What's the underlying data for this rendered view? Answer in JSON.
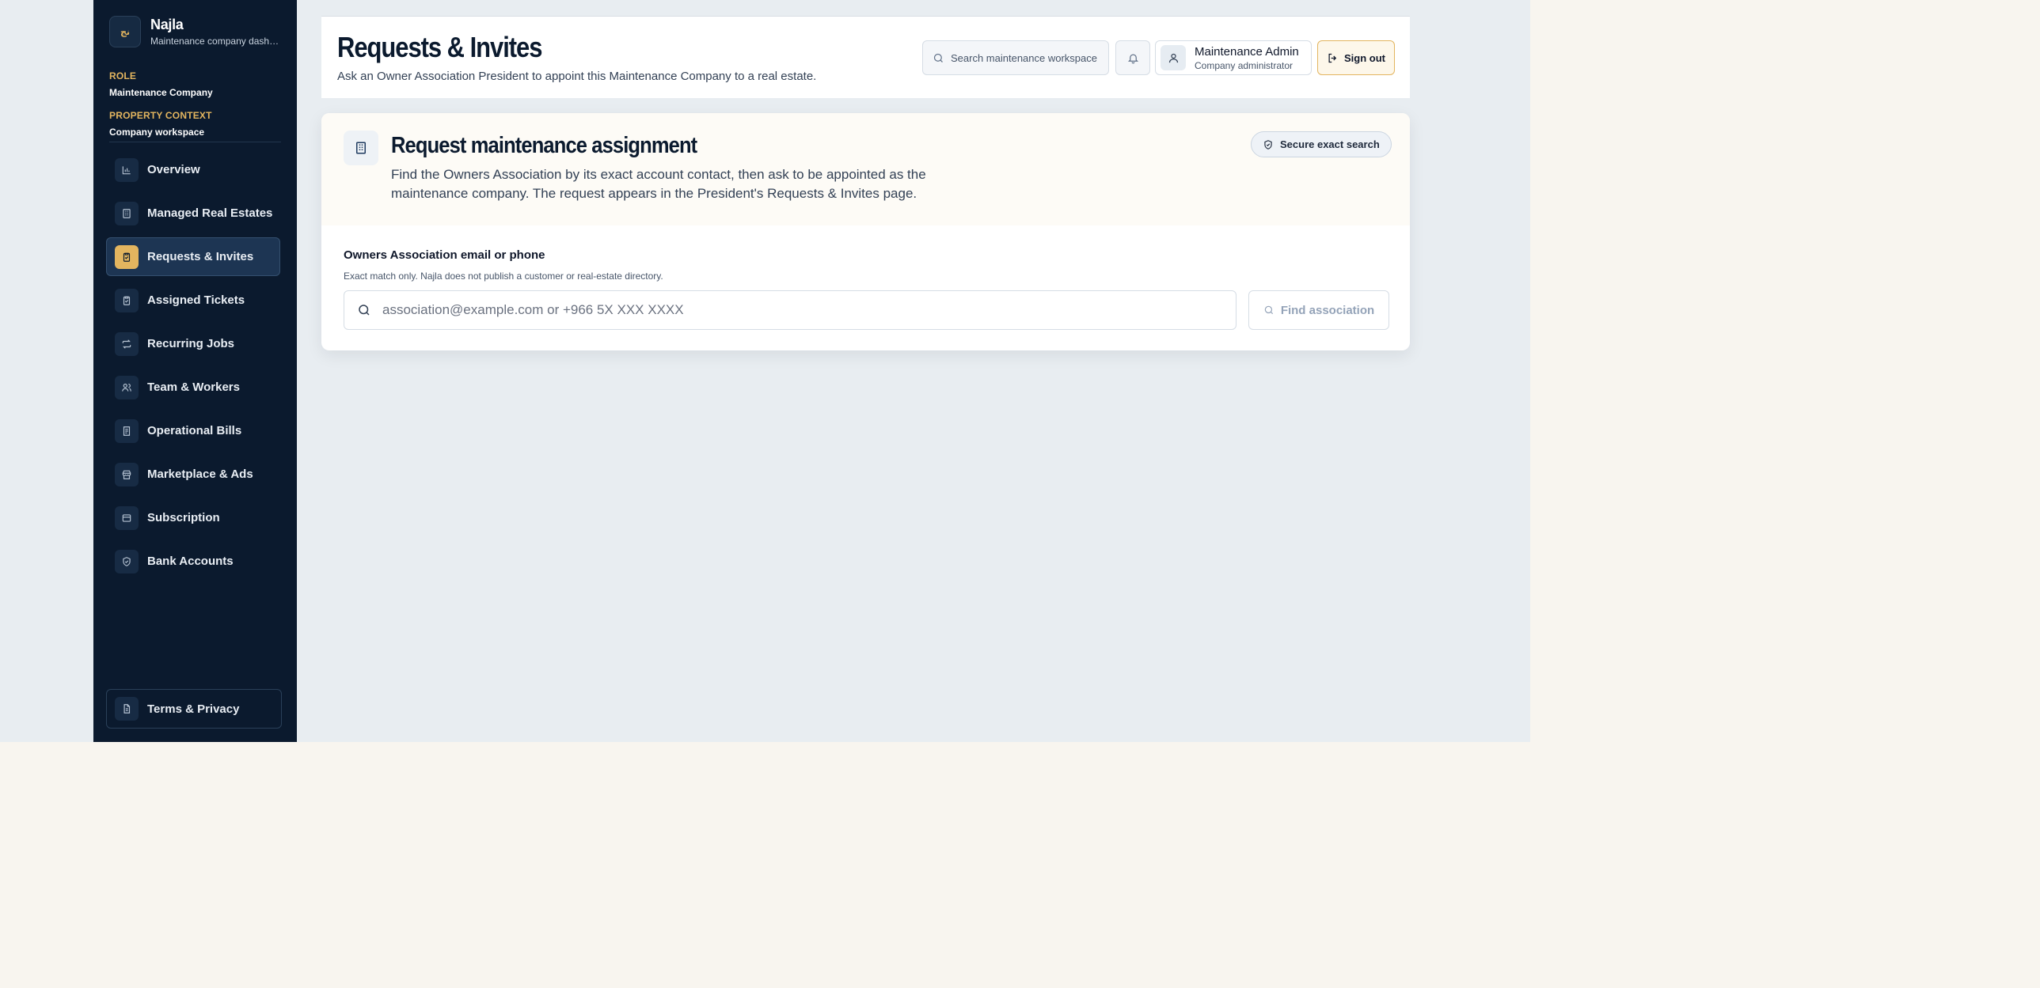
{
  "brand": {
    "name": "Najla",
    "subtitle": "Maintenance company dashboard",
    "logo_text": "نج"
  },
  "role": {
    "key": "ROLE",
    "value": "Maintenance Company"
  },
  "property_context": {
    "key": "PROPERTY CONTEXT",
    "value": "Company workspace"
  },
  "nav": {
    "items": [
      {
        "label": "Overview",
        "icon": "bar-chart-icon"
      },
      {
        "label": "Managed Real Estates",
        "icon": "building-icon"
      },
      {
        "label": "Requests & Invites",
        "icon": "clipboard-icon",
        "active": true
      },
      {
        "label": "Assigned Tickets",
        "icon": "clipboard-check-icon"
      },
      {
        "label": "Recurring Jobs",
        "icon": "repeat-icon"
      },
      {
        "label": "Team & Workers",
        "icon": "users-icon"
      },
      {
        "label": "Operational Bills",
        "icon": "receipt-icon"
      },
      {
        "label": "Marketplace & Ads",
        "icon": "store-icon"
      },
      {
        "label": "Subscription",
        "icon": "wallet-icon"
      },
      {
        "label": "Bank Accounts",
        "icon": "shield-icon"
      }
    ],
    "terms_label": "Terms & Privacy"
  },
  "header": {
    "title": "Requests & Invites",
    "subtitle": "Ask an Owner Association President to appoint this Maintenance Company to a real estate.",
    "search_placeholder": "Search maintenance workspace",
    "user_name": "Maintenance Admin",
    "user_role": "Company administrator",
    "signout_label": "Sign out"
  },
  "card": {
    "title": "Request maintenance assignment",
    "description": "Find the Owners Association by its exact account contact, then ask to be appointed as the maintenance company. The request appears in the President's Requests & Invites page.",
    "badge": "Secure exact search",
    "field_label": "Owners Association email or phone",
    "field_help": "Exact match only. Najla does not publish a customer or real-estate directory.",
    "input_placeholder": "association@example.com or +966 5X XXX XXXX",
    "find_label": "Find association"
  },
  "colors": {
    "sidebar_bg": "#0b1a2e",
    "accent": "#e3b55f",
    "app_bg": "#e8edf1",
    "page_bg": "#f8f5ef"
  }
}
